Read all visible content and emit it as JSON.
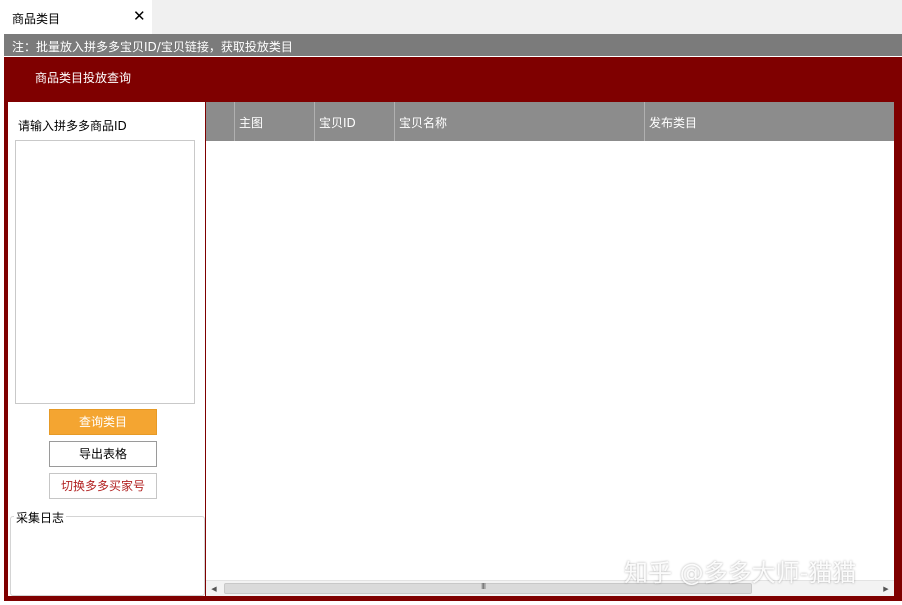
{
  "tab": {
    "title": "商品类目",
    "close_glyph": "✕"
  },
  "notice": "注：批量放入拼多多宝贝ID/宝贝链接，获取投放类目",
  "panel": {
    "title": "商品类目投放查询"
  },
  "left": {
    "input_label": "请输入拼多多商品ID",
    "id_input_value": "",
    "buttons": {
      "query": "查询类目",
      "export": "导出表格",
      "switch_account": "切换多多买家号"
    },
    "log_label": "采集日志",
    "log_content": ""
  },
  "grid": {
    "columns": [
      "",
      "主图",
      "宝贝ID",
      "宝贝名称",
      "发布类目"
    ],
    "rows": []
  },
  "scroll": {
    "grip": "III",
    "up_glyph": "▲",
    "down_glyph": "▼",
    "left_glyph": "◀",
    "right_glyph": "▶"
  },
  "watermark": "知乎 @多多大师-猫猫",
  "colors": {
    "frame": "#7f0000",
    "notice_bar": "#7b7b7b",
    "grid_header": "#8c8c8c",
    "query_button": "#f4a531",
    "switch_text": "#b22222"
  }
}
